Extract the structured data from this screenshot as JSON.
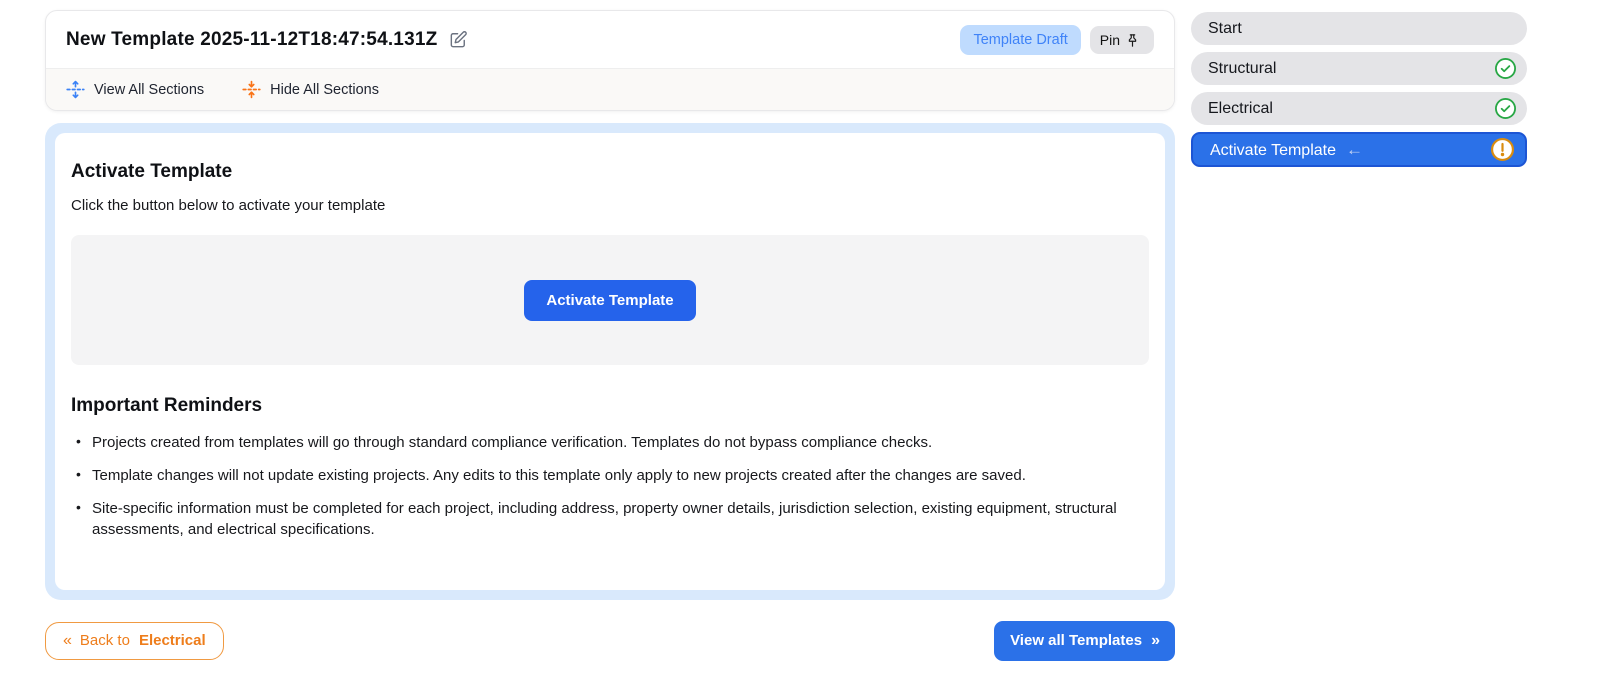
{
  "header": {
    "title": "New Template 2025-11-12T18:47:54.131Z",
    "status_badge": "Template Draft",
    "pin_label": "Pin",
    "toolbar": {
      "view_all_label": "View All Sections",
      "hide_all_label": "Hide All Sections"
    }
  },
  "main": {
    "section_title": "Activate Template",
    "section_subtitle": "Click the button below to activate your template",
    "activate_button_label": "Activate Template",
    "reminders_title": "Important Reminders",
    "reminders": [
      "Projects created from templates will go through standard compliance verification. Templates do not bypass compliance checks.",
      "Template changes will not update existing projects. Any edits to this template only apply to new projects created after the changes are saved.",
      "Site-specific information must be completed for each project, including address, property owner details, jurisdiction selection, existing equipment, structural assessments, and electrical specifications."
    ]
  },
  "footer": {
    "back_chevron": "«",
    "back_prefix": "Back to",
    "back_target": "Electrical",
    "view_templates_label": "View all Templates",
    "view_chevron": "»"
  },
  "sidebar": {
    "items": [
      {
        "label": "Start",
        "status": "none"
      },
      {
        "label": "Structural",
        "status": "complete"
      },
      {
        "label": "Electrical",
        "status": "complete"
      },
      {
        "label": "Activate Template",
        "status": "warning",
        "active": true,
        "arrow": "←"
      }
    ]
  },
  "colors": {
    "accent_blue": "#2563eb",
    "active_item_blue": "#2b71e8",
    "badge_bg": "#bfdbfe",
    "badge_text": "#3f83f8",
    "orange": "#ee7d1b",
    "green": "#28a745",
    "warning_orange": "#d98c0f",
    "panel_blue": "#d9e9fc"
  }
}
